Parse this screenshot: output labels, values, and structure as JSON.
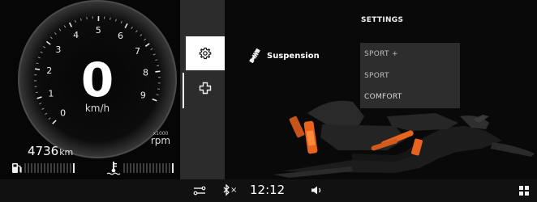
{
  "gauge": {
    "speed_value": "0",
    "speed_unit": "km/h",
    "scale_numbers": [
      "0",
      "1",
      "2",
      "3",
      "4",
      "5",
      "6",
      "7",
      "8",
      "9"
    ],
    "rpm_multiplier": "x1000",
    "rpm_label": "rpm"
  },
  "odometer": {
    "value": "4736",
    "unit": "km"
  },
  "fuel_gauge": {
    "icon": "fuel-pump-icon",
    "level": 0.0
  },
  "coolant_gauge": {
    "icon": "coolant-temperature-icon",
    "level": 0.0
  },
  "menu": {
    "items": [
      {
        "icon": "gear-icon",
        "selected": true
      },
      {
        "icon": "plus-outline-icon",
        "selected": false
      }
    ]
  },
  "settings": {
    "title": "SETTINGS",
    "suspension_label": "Suspension",
    "suspension_icon": "shock-absorber-icon",
    "options": [
      "SPORT +",
      "SPORT",
      "COMFORT"
    ]
  },
  "status_bar": {
    "connection_icon": "connection-status-icon",
    "bluetooth_icon": "bluetooth-icon",
    "bluetooth_state_mark": "×",
    "time": "12:12",
    "volume_icon": "volume-icon",
    "apps_icon": "apps-grid-icon"
  },
  "colors": {
    "background": "#0b0b0b",
    "menu_column": "#2c2c2c",
    "selected_item": "#ffffff",
    "dropdown": "#2d2d2d",
    "vehicle_accent": "#e8641e"
  }
}
